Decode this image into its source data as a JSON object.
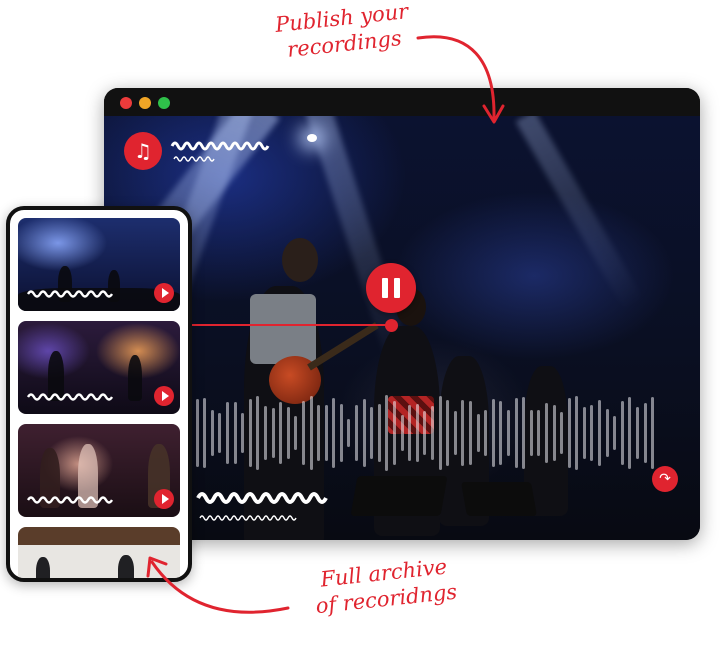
{
  "annotations": {
    "top": [
      "Publish your",
      "recordings"
    ],
    "bottom": [
      "Full archive",
      "of recoridngs"
    ]
  },
  "window": {
    "traffic_lights": [
      "close",
      "minimize",
      "maximize"
    ]
  },
  "player": {
    "music_icon": "♫",
    "share_icon": "↷",
    "state": "playing",
    "accent_color": "#e0242f"
  },
  "phone": {
    "cards": [
      {
        "scene": "concert-blue-lights"
      },
      {
        "scene": "concert-purple-orange"
      },
      {
        "scene": "band-performing"
      },
      {
        "scene": "room-interior"
      }
    ]
  },
  "colors": {
    "accent": "#e0242f",
    "annotation": "#e0242f",
    "window_frame": "#111111"
  }
}
